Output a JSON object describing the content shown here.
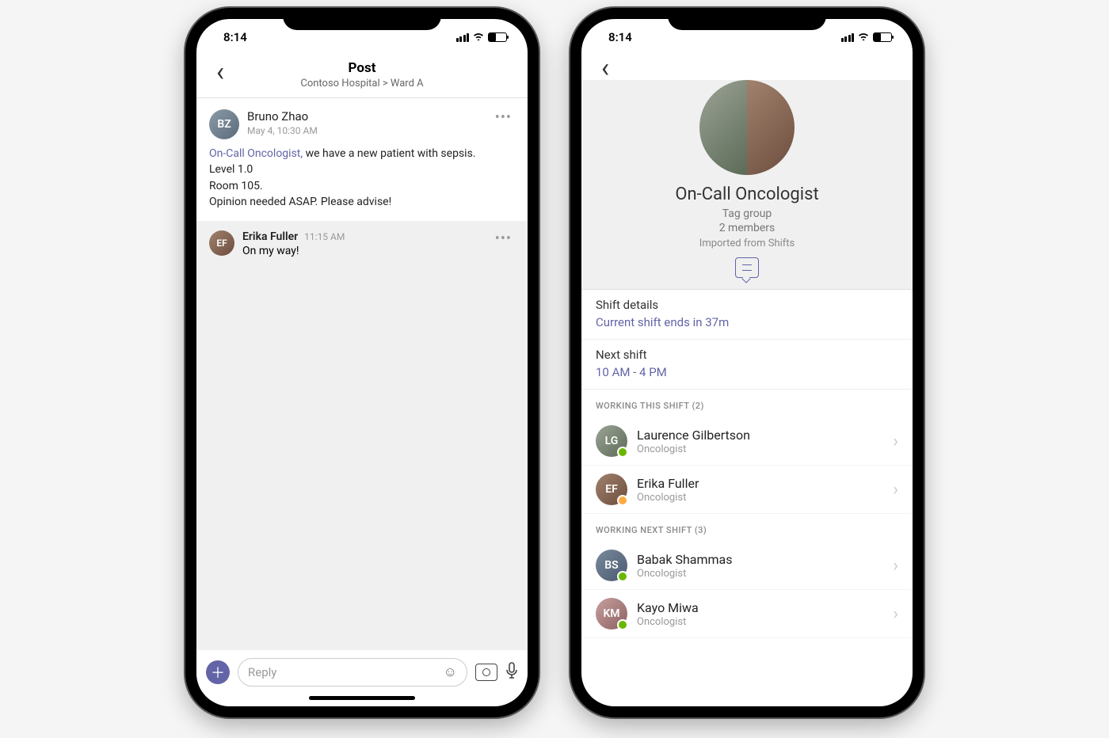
{
  "statusTime": "8:14",
  "left": {
    "nav": {
      "title": "Post",
      "subtitle": "Contoso Hospital > Ward A"
    },
    "post": {
      "author": "Bruno Zhao",
      "time": "May 4, 10:30 AM",
      "mention": "On-Call Oncologist,",
      "line1_rest": " we have a new patient with sepsis.",
      "line2": "Level 1.0",
      "line3": "Room 105.",
      "line4": "Opinion needed ASAP. Please advise!"
    },
    "reply": {
      "author": "Erika Fuller",
      "time": "11:15 AM",
      "text": "On my way!"
    },
    "compose": {
      "placeholder": "Reply"
    }
  },
  "right": {
    "tag": {
      "title": "On-Call Oncologist",
      "type": "Tag group",
      "members": "2 members",
      "source": "Imported from Shifts"
    },
    "shiftDetails": {
      "label": "Shift details",
      "value": "Current shift ends in 37m"
    },
    "nextShift": {
      "label": "Next shift",
      "value": "10 AM - 4 PM"
    },
    "groupA": {
      "label": "WORKING THIS SHIFT (2)",
      "members": [
        {
          "name": "Laurence Gilbertson",
          "role": "Oncologist",
          "presence": "green"
        },
        {
          "name": "Erika Fuller",
          "role": "Oncologist",
          "presence": "yellow"
        }
      ]
    },
    "groupB": {
      "label": "WORKING NEXT SHIFT (3)",
      "members": [
        {
          "name": "Babak Shammas",
          "role": "Oncologist",
          "presence": "green"
        },
        {
          "name": "Kayo Miwa",
          "role": "Oncologist",
          "presence": "green"
        }
      ]
    }
  }
}
